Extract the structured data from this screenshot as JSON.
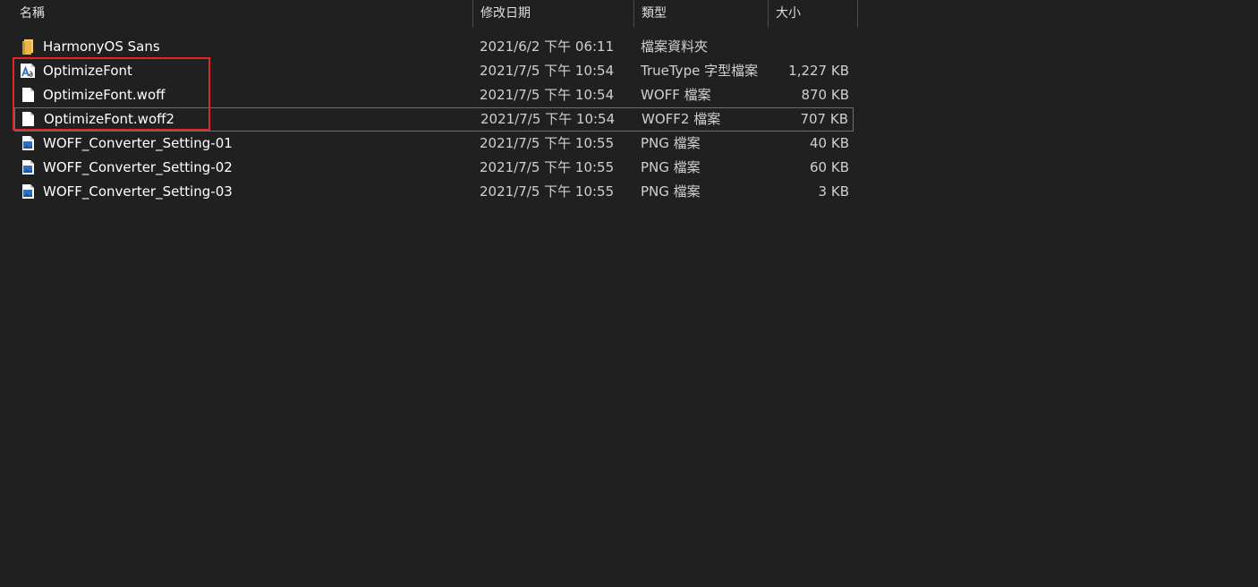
{
  "columns": {
    "name": "名稱",
    "date": "修改日期",
    "type": "類型",
    "size": "大小",
    "sort_indicator": "^"
  },
  "files": [
    {
      "name": "HarmonyOS Sans",
      "date": "2021/6/2 下午 06:11",
      "type": "檔案資料夾",
      "size": "",
      "icon": "folder-icon"
    },
    {
      "name": "OptimizeFont",
      "date": "2021/7/5 下午 10:54",
      "type": "TrueType 字型檔案",
      "size": "1,227 KB",
      "icon": "truetype-font-icon"
    },
    {
      "name": "OptimizeFont.woff",
      "date": "2021/7/5 下午 10:54",
      "type": "WOFF 檔案",
      "size": "870 KB",
      "icon": "file-icon"
    },
    {
      "name": "OptimizeFont.woff2",
      "date": "2021/7/5 下午 10:54",
      "type": "WOFF2 檔案",
      "size": "707 KB",
      "icon": "file-icon"
    },
    {
      "name": "WOFF_Converter_Setting-01",
      "date": "2021/7/5 下午 10:55",
      "type": "PNG 檔案",
      "size": "40 KB",
      "icon": "png-image-icon"
    },
    {
      "name": "WOFF_Converter_Setting-02",
      "date": "2021/7/5 下午 10:55",
      "type": "PNG 檔案",
      "size": "60 KB",
      "icon": "png-image-icon"
    },
    {
      "name": "WOFF_Converter_Setting-03",
      "date": "2021/7/5 下午 10:55",
      "type": "PNG 檔案",
      "size": "3 KB",
      "icon": "png-image-icon"
    }
  ],
  "colors": {
    "background": "#202020",
    "highlight_box": "#e0262b",
    "folder": "#e8b64a",
    "png_icon": "#2f6fc0"
  }
}
